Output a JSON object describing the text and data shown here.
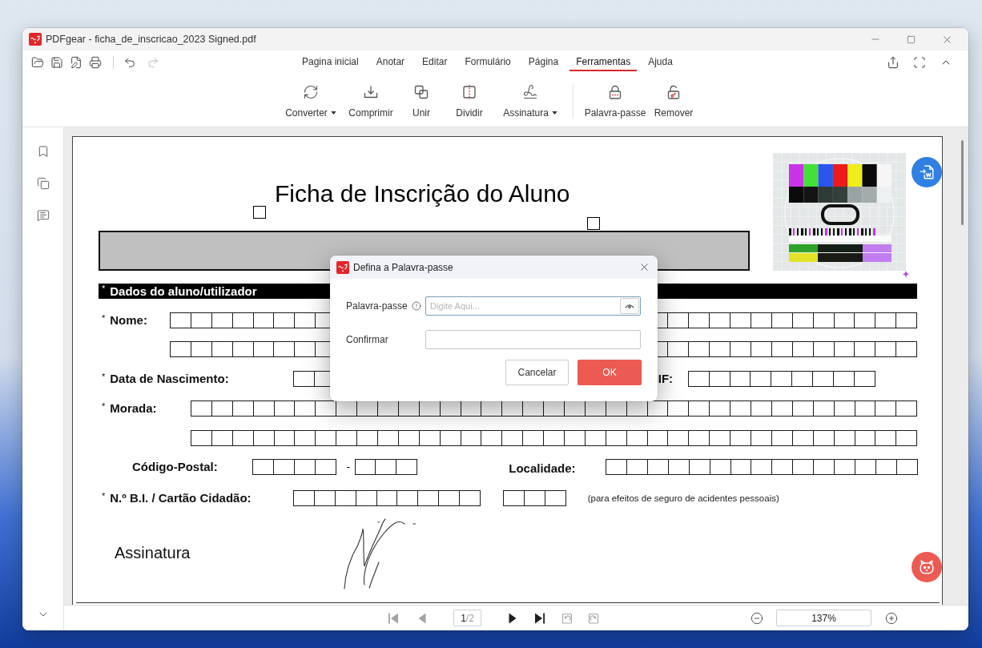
{
  "window": {
    "title": "PDFgear - ficha_de_inscricao_2023 Signed.pdf"
  },
  "history": [
    {
      "disabled": false
    },
    {
      "disabled": true
    }
  ],
  "menu_tabs": [
    {
      "label": "Pagina inicial",
      "selected": false
    },
    {
      "label": "Anotar",
      "selected": false
    },
    {
      "label": "Editar",
      "selected": false
    },
    {
      "label": "Formulário",
      "selected": false
    },
    {
      "label": "Página",
      "selected": false
    },
    {
      "label": "Ferramentas",
      "selected": true
    },
    {
      "label": "Ajuda",
      "selected": false
    }
  ],
  "tool_groups": [
    {
      "tools": [
        {
          "label": "Converter",
          "dropdown": true
        },
        {
          "label": "Comprimir",
          "dropdown": false
        },
        {
          "label": "Unir",
          "dropdown": false
        },
        {
          "label": "Dividir",
          "dropdown": false
        },
        {
          "label": "Assinatura",
          "dropdown": true
        }
      ]
    },
    {
      "tools": [
        {
          "label": "Palavra-passe",
          "dropdown": false
        },
        {
          "label": "Remover",
          "dropdown": false
        }
      ]
    }
  ],
  "document": {
    "title": "Ficha de Inscrição do Aluno",
    "section": {
      "mark": "*",
      "label": "Dados do aluno/utilizador"
    },
    "name": {
      "mark": "*",
      "label": "Nome:"
    },
    "birth_date": {
      "mark": "*",
      "label": "Data de Nascimento:"
    },
    "tax_id": {
      "label": "IF:"
    },
    "address": {
      "mark": "*",
      "label": "Morada:"
    },
    "postal_code": {
      "label": "Código-Postal:",
      "separator": "-"
    },
    "locality": {
      "label": "Localidade:"
    },
    "id_card": {
      "mark": "*",
      "label": "N.º B.I. / Cartão Cidadão:",
      "note": "(para efeitos de seguro de acidentes pessoais)"
    },
    "signature": {
      "label": "Assinatura"
    }
  },
  "dialog": {
    "title": "Defina a Palavra-passe",
    "fields": [
      {
        "label": "Palavra-passe",
        "placeholder": "Digite Aqui...",
        "focused": true,
        "info": true,
        "reveal": true
      },
      {
        "label": "Confirmar",
        "focused": false
      }
    ],
    "buttons": [
      {
        "label": "Cancelar",
        "kind": "secondary"
      },
      {
        "label": "OK",
        "kind": "primary"
      }
    ]
  },
  "pager": {
    "nav": [
      {
        "disabled": true
      },
      {
        "disabled": true
      },
      {
        "disabled": false
      },
      {
        "disabled": false
      }
    ],
    "current": "1",
    "total": "/2",
    "rotate": [
      {
        "disabled": true
      },
      {
        "disabled": true
      }
    ]
  },
  "zoom": {
    "value": "137%"
  }
}
